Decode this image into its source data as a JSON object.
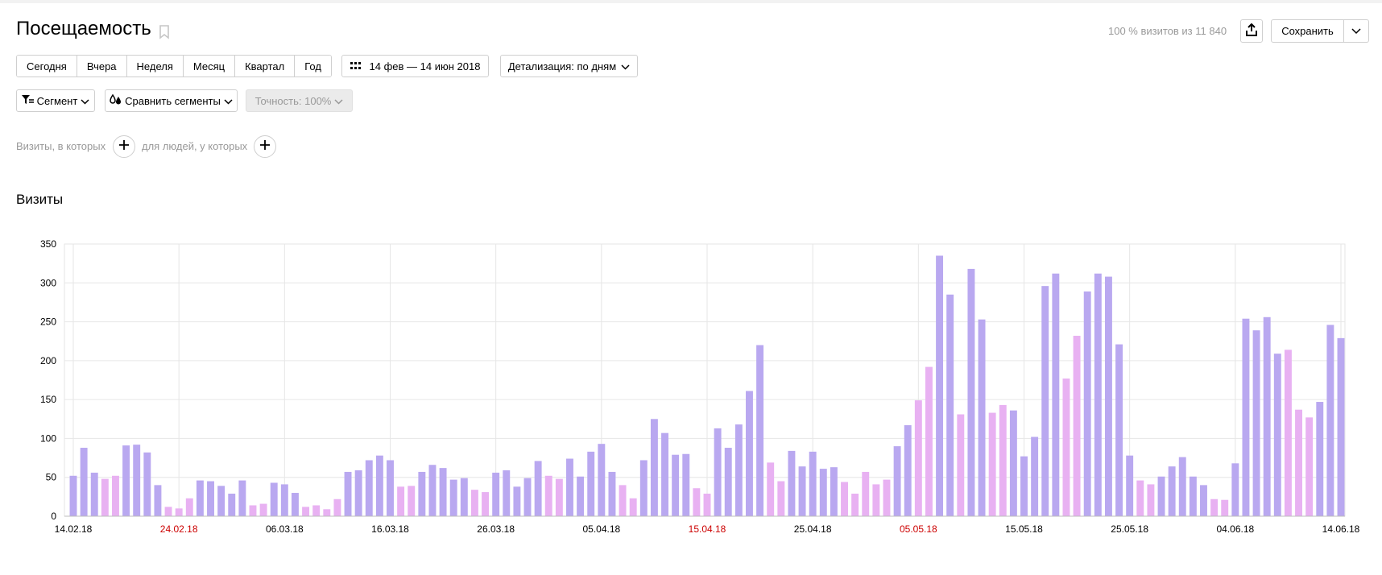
{
  "header": {
    "title": "Посещаемость",
    "visits_note": "100 % визитов из 11 840",
    "save_label": "Сохранить"
  },
  "periods": [
    "Сегодня",
    "Вчера",
    "Неделя",
    "Месяц",
    "Квартал",
    "Год"
  ],
  "date_range": "14 фев — 14 июн 2018",
  "detail_label": "Детализация: по дням",
  "filters": {
    "segment_label": "Сегмент",
    "compare_label": "Сравнить сегменты",
    "accuracy_label": "Точность: 100%"
  },
  "conditions": {
    "visits_label": "Визиты, в которых",
    "people_label": "для людей, у которых"
  },
  "colors": {
    "weekday_bar": "#b9a8f0",
    "weekend_bar": "#e8b1f2",
    "holiday_tick": "#cc0000",
    "grid": "#e6e6e6"
  },
  "icons": [
    "bookmark-icon",
    "export-icon",
    "chevron-down-icon",
    "calendar-grid-icon",
    "segment-filter-icon",
    "compare-drops-icon",
    "plus-icon"
  ],
  "chart_data": {
    "type": "bar",
    "title": "Визиты",
    "xlabel": "",
    "ylabel": "",
    "ylim": [
      0,
      350
    ],
    "yticks": [
      0,
      50,
      100,
      150,
      200,
      250,
      300,
      350
    ],
    "grid": true,
    "x_tick_labels": [
      {
        "label": "14.02.18",
        "index": 0,
        "holiday": false
      },
      {
        "label": "24.02.18",
        "index": 10,
        "holiday": true
      },
      {
        "label": "06.03.18",
        "index": 20,
        "holiday": false
      },
      {
        "label": "16.03.18",
        "index": 30,
        "holiday": false
      },
      {
        "label": "26.03.18",
        "index": 40,
        "holiday": false
      },
      {
        "label": "05.04.18",
        "index": 50,
        "holiday": false
      },
      {
        "label": "15.04.18",
        "index": 60,
        "holiday": true
      },
      {
        "label": "25.04.18",
        "index": 70,
        "holiday": false
      },
      {
        "label": "05.05.18",
        "index": 80,
        "holiday": true
      },
      {
        "label": "15.05.18",
        "index": 90,
        "holiday": false
      },
      {
        "label": "25.05.18",
        "index": 100,
        "holiday": false
      },
      {
        "label": "04.06.18",
        "index": 110,
        "holiday": false
      },
      {
        "label": "14.06.18",
        "index": 120,
        "holiday": false
      }
    ],
    "values": [
      52,
      88,
      56,
      48,
      52,
      91,
      92,
      82,
      40,
      12,
      10,
      23,
      46,
      45,
      39,
      29,
      46,
      14,
      16,
      43,
      41,
      30,
      12,
      14,
      9,
      22,
      57,
      59,
      72,
      78,
      72,
      38,
      39,
      57,
      66,
      62,
      47,
      49,
      34,
      31,
      56,
      59,
      38,
      49,
      71,
      52,
      48,
      74,
      51,
      83,
      93,
      57,
      40,
      23,
      72,
      125,
      107,
      79,
      80,
      36,
      29,
      113,
      88,
      118,
      161,
      220,
      69,
      45,
      84,
      64,
      83,
      61,
      63,
      44,
      29,
      57,
      41,
      47,
      90,
      117,
      149,
      192,
      335,
      285,
      131,
      318,
      253,
      133,
      143,
      136,
      77,
      102,
      296,
      312,
      177,
      232,
      289,
      312,
      308,
      221,
      78,
      46,
      41,
      51,
      64,
      76,
      51,
      40,
      22,
      21,
      68,
      254,
      239,
      256,
      209,
      214,
      137,
      127,
      147,
      246,
      229
    ],
    "weekend_flags": [
      0,
      0,
      0,
      1,
      1,
      0,
      0,
      0,
      0,
      1,
      1,
      1,
      0,
      0,
      0,
      0,
      0,
      1,
      1,
      0,
      0,
      0,
      1,
      1,
      1,
      1,
      0,
      0,
      0,
      0,
      0,
      1,
      1,
      0,
      0,
      0,
      0,
      0,
      1,
      1,
      0,
      0,
      0,
      0,
      0,
      1,
      1,
      0,
      0,
      0,
      0,
      0,
      1,
      1,
      0,
      0,
      0,
      0,
      0,
      1,
      1,
      0,
      0,
      0,
      0,
      0,
      1,
      1,
      0,
      0,
      0,
      0,
      0,
      1,
      1,
      1,
      1,
      1,
      0,
      0,
      1,
      1,
      0,
      0,
      1,
      0,
      0,
      1,
      1,
      0,
      0,
      0,
      0,
      0,
      1,
      1,
      0,
      0,
      0,
      0,
      0,
      1,
      1,
      0,
      0,
      0,
      0,
      0,
      1,
      1,
      0,
      0,
      0,
      0,
      0,
      1,
      1,
      1,
      0,
      0,
      0
    ]
  }
}
